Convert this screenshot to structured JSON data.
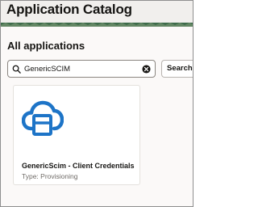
{
  "header": {
    "title": "Application Catalog"
  },
  "section": {
    "title": "All applications"
  },
  "search": {
    "value": "GenericSCIM",
    "button_label": "Search",
    "icon": "search-icon",
    "clear_icon": "clear-icon"
  },
  "results": [
    {
      "name": "GenericScim - Client Credentials",
      "type_label": "Type: Provisioning",
      "icon": "cloud-app-icon"
    }
  ],
  "colors": {
    "accent": "#1d74c7",
    "header_bg": "#f1efed",
    "header_pattern": "#3d6b4a",
    "text": "#161513"
  }
}
